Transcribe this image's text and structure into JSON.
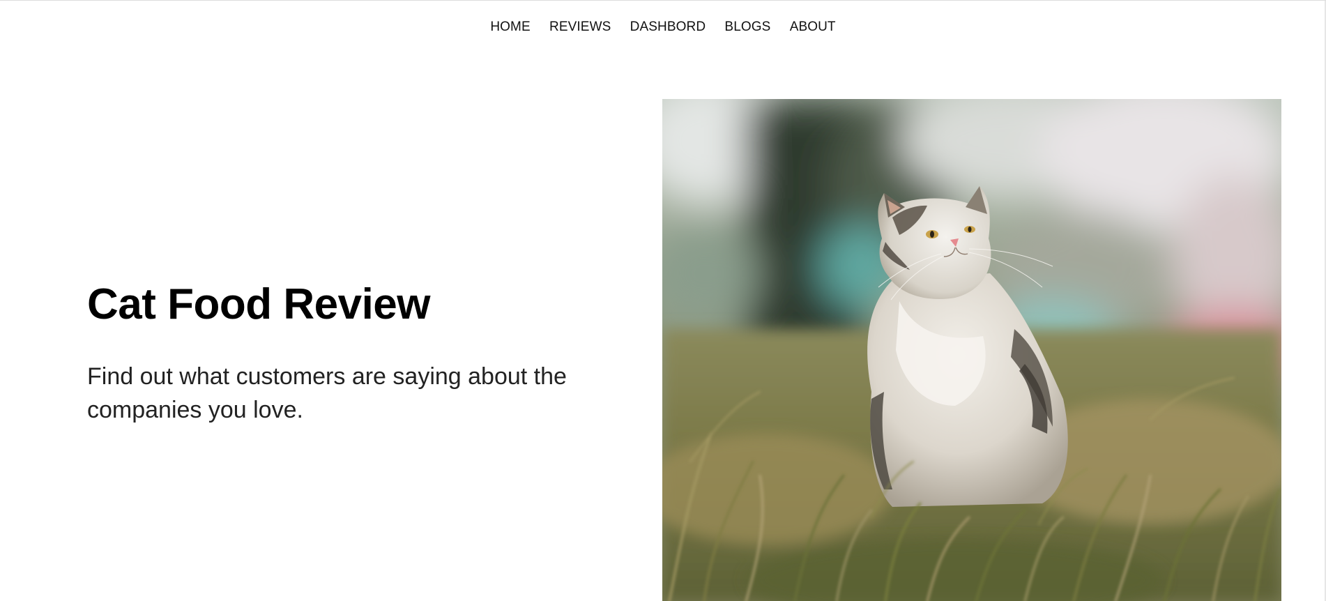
{
  "nav": {
    "items": [
      {
        "label": "HOME"
      },
      {
        "label": "REVIEWS"
      },
      {
        "label": "DASHBORD"
      },
      {
        "label": "BLOGS"
      },
      {
        "label": "ABOUT"
      }
    ]
  },
  "hero": {
    "title": "Cat Food Review",
    "subtitle": "Find out what customers are saying about the companies you love.",
    "image": "cat-sitting-in-grass-photo"
  },
  "colors": {
    "text": "#111111",
    "background": "#ffffff"
  }
}
